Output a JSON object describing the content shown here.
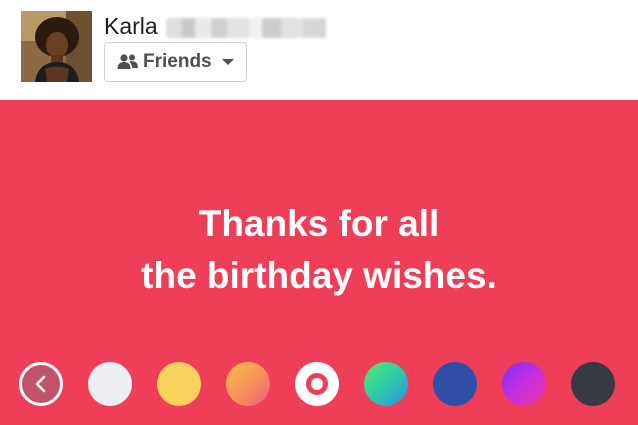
{
  "user": {
    "name": "Karla",
    "avatar": "profile-photo"
  },
  "audience": {
    "label": "Friends",
    "icon": "friends-icon"
  },
  "post": {
    "background_color": "#ef3e58",
    "text_lines": [
      "Thanks for all",
      "the birthday wishes."
    ]
  },
  "background_picker": {
    "back_icon": "chevron-left-icon",
    "swatches": [
      {
        "name": "light-gray",
        "color": "#eceef1"
      },
      {
        "name": "yellow",
        "color": "#f9d25b"
      },
      {
        "name": "orange-pink-gradient",
        "color": "#f7a14f"
      },
      {
        "name": "red-selected",
        "color": "#ef3e58",
        "selected": true
      },
      {
        "name": "green-blue-gradient",
        "color": "#2fd07a"
      },
      {
        "name": "dark-blue",
        "color": "#2f4fa6"
      },
      {
        "name": "purple-pink-gradient",
        "color": "#b62fe6"
      },
      {
        "name": "charcoal",
        "color": "#363b43"
      }
    ]
  }
}
